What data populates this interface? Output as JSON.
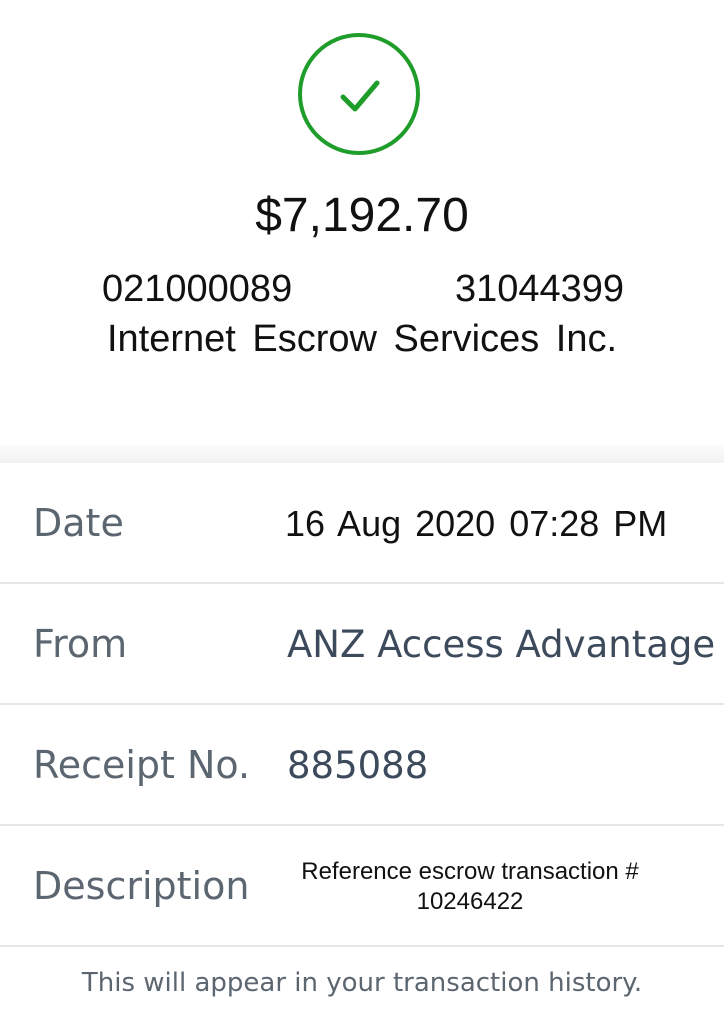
{
  "receipt": {
    "status_icon": "checkmark-circle-icon",
    "accent_color": "#1f9d2a",
    "amount": "$7,192.70",
    "routing_number": "021000089",
    "account_number": "31044399",
    "payee_name": "Internet Escrow Services Inc."
  },
  "details": {
    "date_label": "Date",
    "date_value": "16 Aug 2020 07:28 PM",
    "from_label": "From",
    "from_value": "ANZ Access Advantage",
    "receipt_label": "Receipt No.",
    "receipt_value": "885088",
    "description_label": "Description",
    "description_line1": "Reference escrow transaction #",
    "description_line2": "10246422"
  },
  "footer": {
    "note": "This will appear in your transaction history."
  }
}
